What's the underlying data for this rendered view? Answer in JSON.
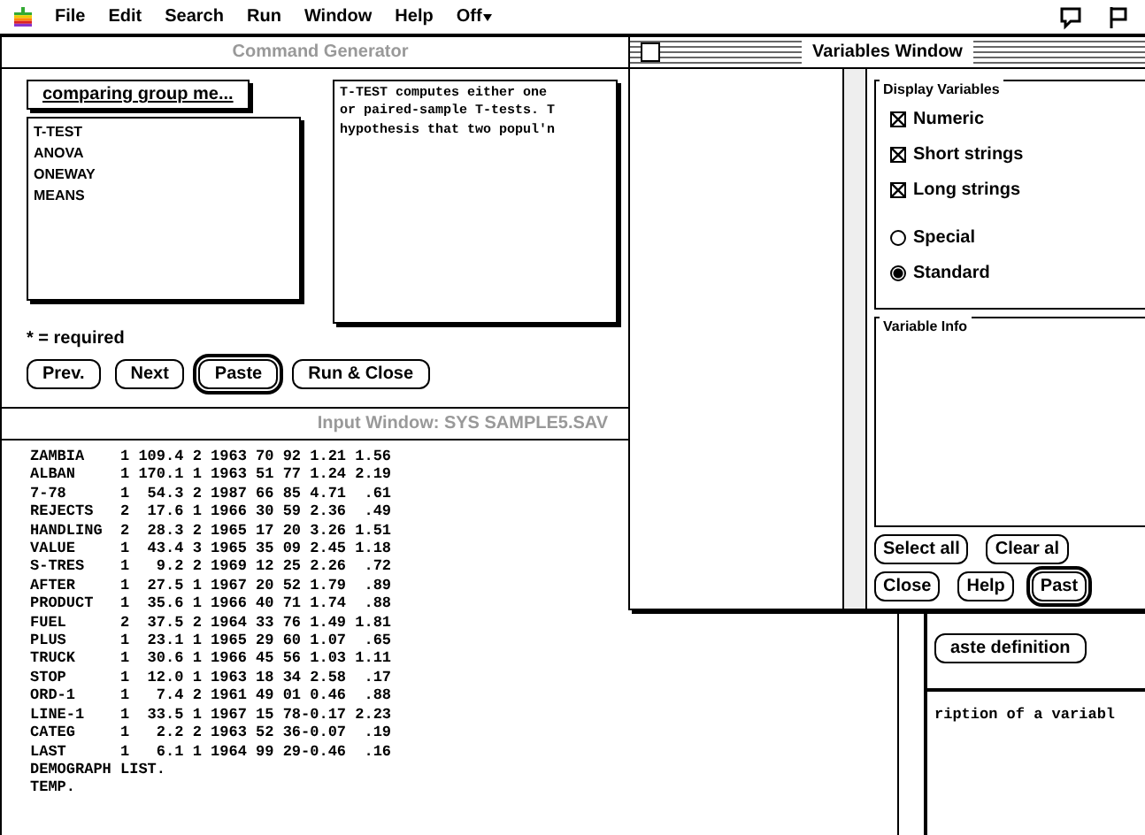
{
  "menu_bar": {
    "items": [
      "File",
      "Edit",
      "Search",
      "Run",
      "Window",
      "Help",
      "Off"
    ]
  },
  "command_window": {
    "title": "Command Generator",
    "active": false,
    "dropdown": "comparing group me...",
    "list_items": [
      "T-TEST",
      "ANOVA",
      "ONEWAY",
      "MEANS"
    ],
    "description": [
      "T-TEST computes either one",
      "or paired-sample T-tests. T",
      "hypothesis that two popul'n"
    ],
    "required_note": "* = required",
    "buttons": [
      {
        "label": "Prev.",
        "default": false
      },
      {
        "label": "Next",
        "default": false
      },
      {
        "label": "Paste",
        "default": true
      },
      {
        "label": "Run & Close",
        "default": false
      }
    ]
  },
  "output_window": {
    "title": "Input Window: SYS SAMPLE5.SAV",
    "active": false,
    "lines": [
      "ZAMBIA    1 109.4 2 1963 70 92 1.21 1.56",
      "ALBAN     1 170.1 1 1963 51 77 1.24 2.19",
      "7-78      1  54.3 2 1987 66 85 4.71  .61",
      "REJECTS   2  17.6 1 1966 30 59 2.36  .49",
      "HANDLING  2  28.3 2 1965 17 20 3.26 1.51",
      "VALUE     1  43.4 3 1965 35 09 2.45 1.18",
      "S-TRES    1   9.2 2 1969 12 25 2.26  .72",
      "AFTER     1  27.5 1 1967 20 52 1.79  .89",
      "PRODUCT   1  35.6 1 1966 40 71 1.74  .88",
      "FUEL      2  37.5 2 1964 33 76 1.49 1.81",
      "PLUS      1  23.1 1 1965 29 60 1.07  .65",
      "TRUCK     1  30.6 1 1966 45 56 1.03 1.11",
      "STOP      1  12.0 1 1963 18 34 2.58  .17",
      "ORD-1     1   7.4 2 1961 49 01 0.46  .88",
      "LINE-1    1  33.5 1 1967 15 78-0.17 2.23",
      "CATEG     1   2.2 2 1963 52 36-0.07  .19",
      "LAST      1   6.1 1 1964 99 29-0.46  .16",
      "DEMOGRAPH LIST.",
      "TEMP."
    ]
  },
  "variables_window": {
    "title": "Variables Window",
    "active": true,
    "display_group": {
      "title": "Display Variables",
      "options": [
        {
          "kind": "checkbox",
          "label": "Numeric",
          "checked": true
        },
        {
          "kind": "checkbox",
          "label": "Short strings",
          "checked": true
        },
        {
          "kind": "checkbox",
          "label": "Long strings",
          "checked": true
        },
        {
          "kind": "radio",
          "label": "Special",
          "selected": false
        },
        {
          "kind": "radio",
          "label": "Standard",
          "selected": true
        }
      ]
    },
    "info_group": {
      "title": "Variable Info"
    },
    "button_rows": [
      [
        {
          "label": "Select all",
          "default": false
        },
        {
          "label": "Clear al",
          "default": false
        }
      ],
      [
        {
          "label": "Close",
          "default": false
        },
        {
          "label": "Help",
          "default": false
        },
        {
          "label": "Past",
          "default": true
        }
      ]
    ]
  },
  "back_window": {
    "button": "aste definition",
    "text": "ription of a variabl"
  }
}
